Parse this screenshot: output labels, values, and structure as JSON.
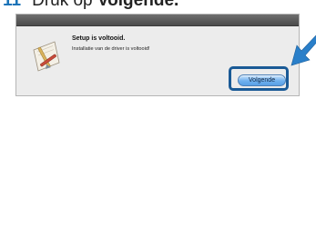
{
  "step": {
    "number": "11",
    "prefix": "Druk op ",
    "action": "Volgende."
  },
  "dialog": {
    "title": "Setup is voltooid.",
    "message": "Installatie van de driver is voltooid!",
    "button_label": "Volgende"
  },
  "colors": {
    "step_number": "#1a73b8",
    "highlight": "#1a5a96",
    "arrow": "#2a7fc9"
  },
  "icons": {
    "installer": "installer-package-icon",
    "pointer": "arrow-pointer-icon"
  }
}
